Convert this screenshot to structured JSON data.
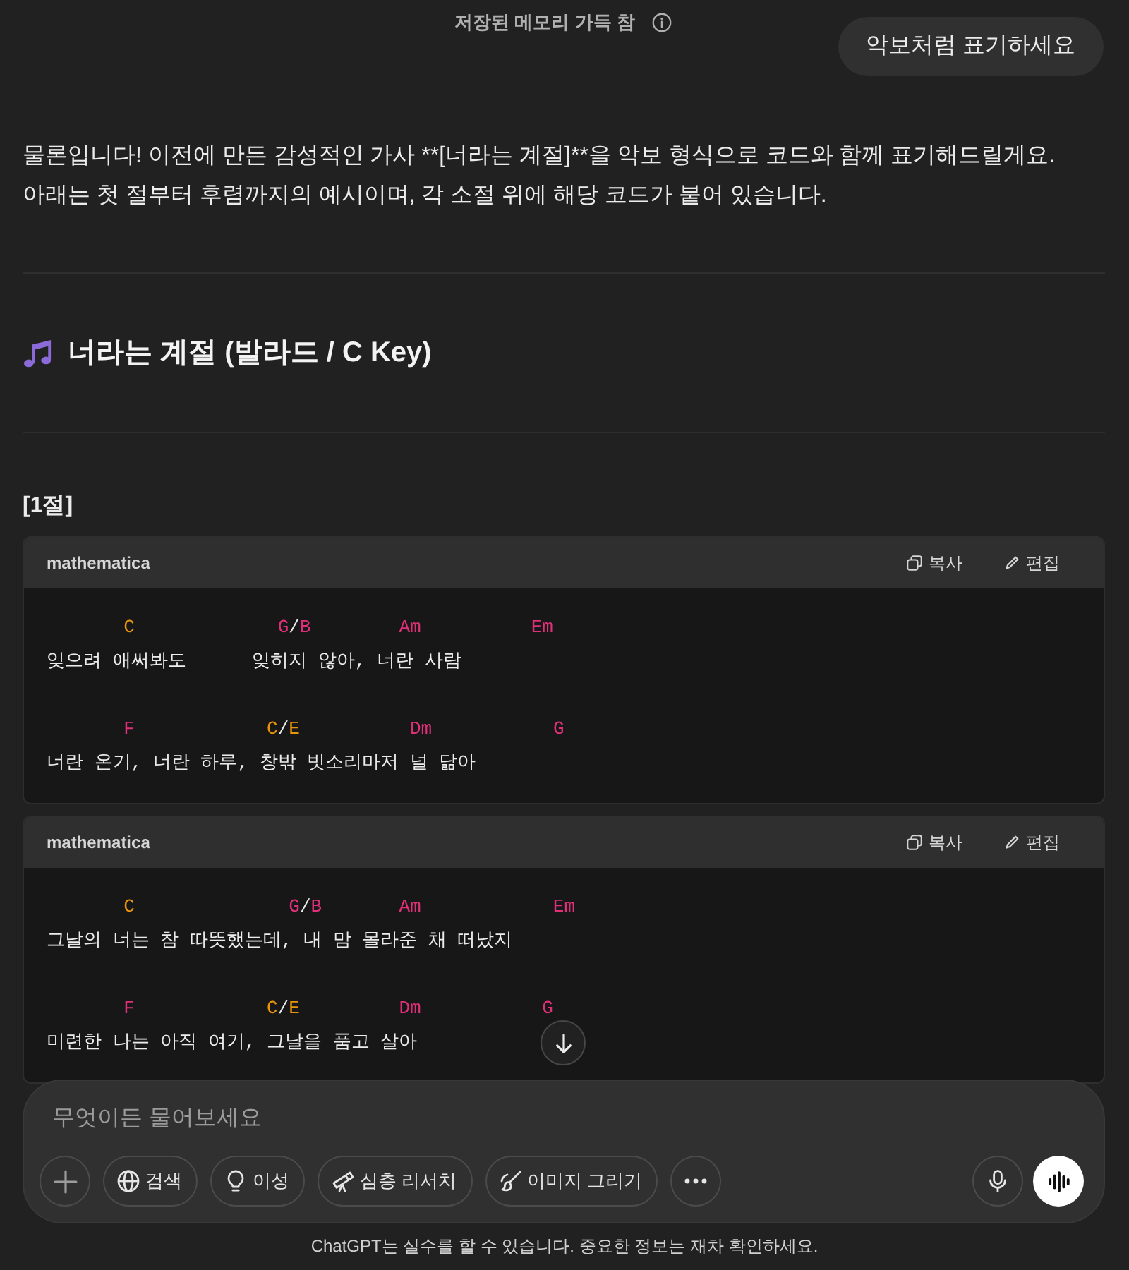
{
  "header": {
    "notice": "저장된 메모리 가득 참"
  },
  "user_message": {
    "text": "악보처럼 표기하세요"
  },
  "assistant": {
    "intro": "물론입니다! 이전에 만든 감성적인 가사 **[너라는 계절]**을 악보 형식으로 코드와 함께 표기해드릴게요. 아래는 첫 절부터 후렴까지의 예시이며, 각 소절 위에 해당 코드가 붙어 있습니다.",
    "title": "너라는 계절 (발라드 / C Key)",
    "section_label": "[1절]",
    "code_blocks": [
      {
        "language": "mathematica",
        "actions": [
          {
            "kind": "copy",
            "label": "복사"
          },
          {
            "kind": "edit",
            "label": "편집"
          }
        ],
        "lines": [
          {
            "kind": "chords",
            "text": "       C             G/B        Am          Em",
            "chords": [
              {
                "color": "#e9950c"
              },
              {
                "color": "#df3079"
              },
              {
                "color": "#df3079"
              },
              {
                "color": "#df3079"
              }
            ]
          },
          {
            "kind": "lyric",
            "text": "잊으려 애써봐도      잊히지 않아, 너란 사람"
          },
          {
            "kind": "blank"
          },
          {
            "kind": "chords",
            "text": "       F            C/E          Dm           G",
            "chords": [
              {
                "color": "#df3079"
              },
              {
                "color": "#e9950c"
              },
              {
                "color": "#df3079"
              },
              {
                "color": "#df3079"
              }
            ]
          },
          {
            "kind": "lyric",
            "text": "너란 온기, 너란 하루, 창밖 빗소리마저 널 닮아"
          }
        ]
      },
      {
        "language": "mathematica",
        "actions": [
          {
            "kind": "copy",
            "label": "복사"
          },
          {
            "kind": "edit",
            "label": "편집"
          }
        ],
        "lines": [
          {
            "kind": "chords",
            "text": "       C              G/B       Am            Em",
            "chords": [
              {
                "color": "#e9950c"
              },
              {
                "color": "#df3079"
              },
              {
                "color": "#df3079"
              },
              {
                "color": "#df3079"
              }
            ]
          },
          {
            "kind": "lyric",
            "text": "그날의 너는 참 따뜻했는데, 내 맘 몰라준 채 떠났지"
          },
          {
            "kind": "blank"
          },
          {
            "kind": "chords",
            "text": "       F            C/E         Dm           G",
            "chords": [
              {
                "color": "#df3079"
              },
              {
                "color": "#e9950c"
              },
              {
                "color": "#df3079"
              },
              {
                "color": "#df3079"
              }
            ]
          },
          {
            "kind": "lyric",
            "text": "미련한 나는 아직 여기, 그날을 품고 살아"
          }
        ]
      }
    ]
  },
  "composer": {
    "placeholder": "무엇이든 물어보세요",
    "tools": [
      {
        "kind": "search",
        "label": "검색"
      },
      {
        "kind": "reason",
        "label": "이성"
      },
      {
        "kind": "research",
        "label": "심층 리서치"
      },
      {
        "kind": "image",
        "label": "이미지 그리기"
      }
    ]
  },
  "footer": {
    "disclaimer": "ChatGPT는 실수를 할 수 있습니다. 중요한 정보는 재차 확인하세요."
  }
}
